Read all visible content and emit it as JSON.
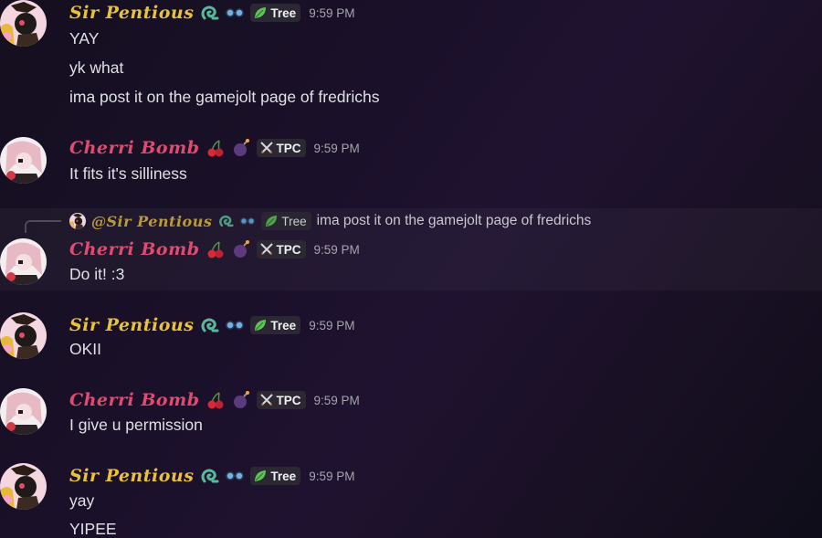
{
  "colors": {
    "sir_pentious": "#e9c23b",
    "cherri_bomb": "#e34a6f",
    "tag_bg": "#2b2733",
    "timestamp": "#a5a5ad"
  },
  "messages": [
    {
      "username": "Sir Pentious",
      "badges": [
        "snake-emoji",
        "glasses-emoji"
      ],
      "tag": "Tree",
      "tag_icon": "leaf-icon",
      "time": "9:59 PM",
      "lines": [
        "YAY",
        "yk what",
        "ima post it on the gamejolt page of fredrichs"
      ]
    },
    {
      "username": "Cherri Bomb",
      "badges": [
        "cherries-emoji",
        "bomb-emoji"
      ],
      "tag": "TPC",
      "tag_icon": "crossed-swords-icon",
      "time": "9:59 PM",
      "lines": [
        "It fits it's silliness"
      ]
    },
    {
      "reply": {
        "mention": "@Sir Pentious",
        "tag": "Tree",
        "text": "ima post it on the gamejolt page of fredrichs"
      },
      "username": "Cherri Bomb",
      "badges": [
        "cherries-emoji",
        "bomb-emoji"
      ],
      "tag": "TPC",
      "tag_icon": "crossed-swords-icon",
      "time": "9:59 PM",
      "lines": [
        "Do it! :3"
      ]
    },
    {
      "username": "Sir Pentious",
      "badges": [
        "snake-emoji",
        "glasses-emoji"
      ],
      "tag": "Tree",
      "tag_icon": "leaf-icon",
      "time": "9:59 PM",
      "lines": [
        "OKII"
      ]
    },
    {
      "username": "Cherri Bomb",
      "badges": [
        "cherries-emoji",
        "bomb-emoji"
      ],
      "tag": "TPC",
      "tag_icon": "crossed-swords-icon",
      "time": "9:59 PM",
      "lines": [
        "I give u permission"
      ]
    },
    {
      "username": "Sir Pentious",
      "badges": [
        "snake-emoji",
        "glasses-emoji"
      ],
      "tag": "Tree",
      "tag_icon": "leaf-icon",
      "time": "9:59 PM",
      "lines": [
        "yay",
        "YIPEE"
      ]
    }
  ]
}
